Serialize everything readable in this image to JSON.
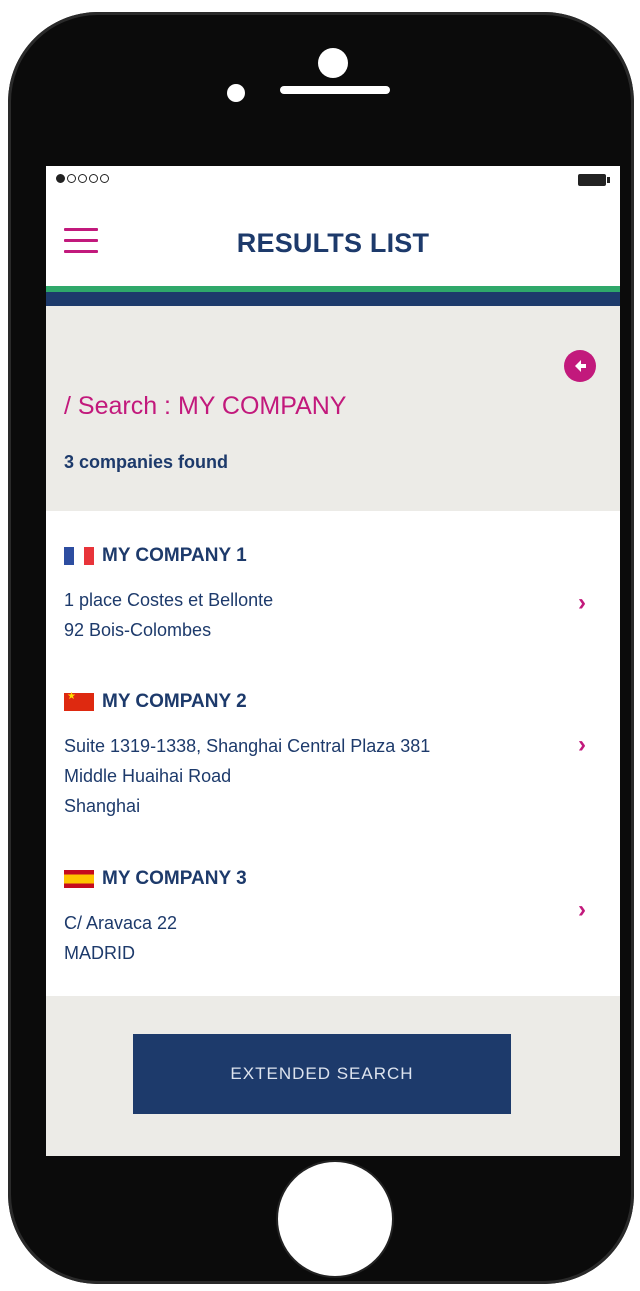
{
  "status_bar": {
    "signal_dots_filled": 1,
    "signal_dots_total": 5
  },
  "header": {
    "title": "RESULTS LIST"
  },
  "search": {
    "title": "/ Search : MY COMPANY",
    "count_text": "3 companies found"
  },
  "results": [
    {
      "name": "MY COMPANY 1",
      "flag": "france-flag",
      "address_lines": [
        "1 place Costes et Bellonte",
        "92 Bois-Colombes"
      ]
    },
    {
      "name": "MY COMPANY 2",
      "flag": "china-flag",
      "address_lines": [
        "Suite 1319-1338, Shanghai Central Plaza 381",
        "Middle Huaihai Road",
        "Shanghai"
      ]
    },
    {
      "name": "MY COMPANY 3",
      "flag": "spain-flag",
      "address_lines": [
        "C/ Aravaca 22",
        "MADRID"
      ]
    }
  ],
  "footer": {
    "extended_search_label": "EXTENDED SEARCH"
  },
  "colors": {
    "accent": "#c2197c",
    "navy": "#1d3a6b",
    "green": "#2fa86a",
    "panel_bg": "#ecebe7"
  },
  "icons": {
    "menu": "hamburger-menu-icon",
    "back": "back-arrow-icon",
    "chevron": "chevron-right-icon"
  }
}
